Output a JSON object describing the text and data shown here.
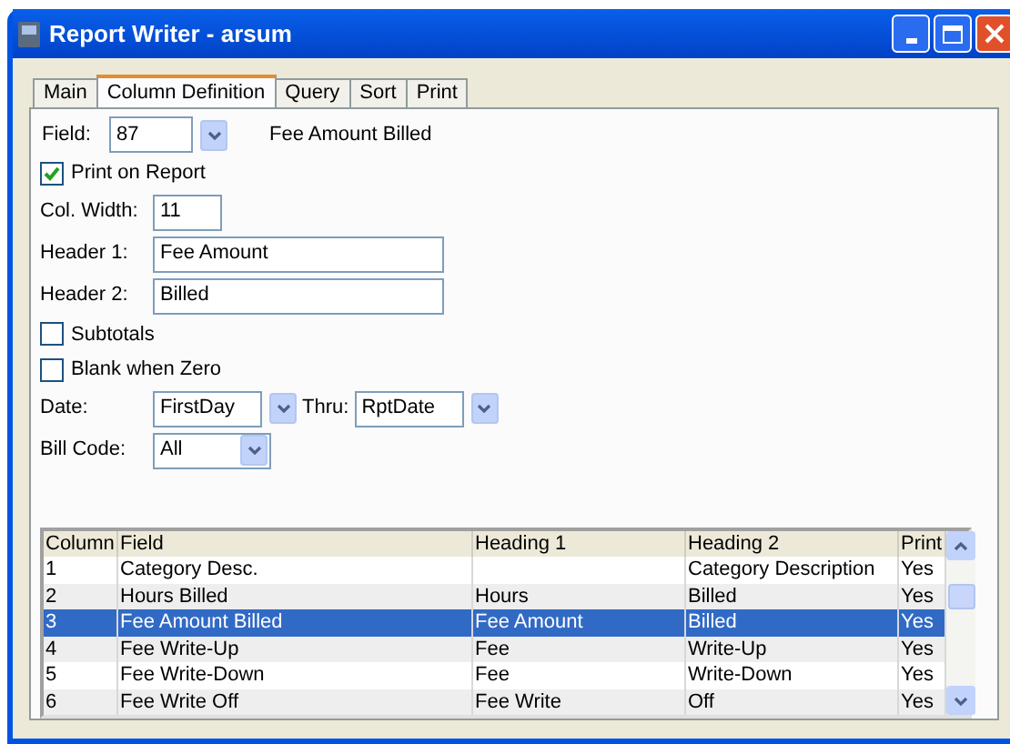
{
  "window": {
    "title": "Report Writer - arsum"
  },
  "tabs": [
    {
      "label": "Main",
      "selected": false
    },
    {
      "label": "Column Definition",
      "selected": true
    },
    {
      "label": "Query",
      "selected": false
    },
    {
      "label": "Sort",
      "selected": false
    },
    {
      "label": "Print",
      "selected": false
    }
  ],
  "field": {
    "label": "Field:",
    "value": "87",
    "description": "Fee Amount Billed"
  },
  "print_on_report": {
    "label": "Print on Report",
    "checked": true
  },
  "col_width": {
    "label": "Col. Width:",
    "value": "11"
  },
  "header_1": {
    "label": "Header 1:",
    "value": "Fee Amount"
  },
  "header_2": {
    "label": "Header 2:",
    "value": "Billed"
  },
  "subtotals": {
    "label": "Subtotals",
    "checked": false
  },
  "blank_when_zero": {
    "label": "Blank when Zero",
    "checked": false
  },
  "date": {
    "label": "Date:",
    "value": "FirstDay",
    "thru_label": "Thru:",
    "thru_value": "RptDate"
  },
  "bill_code": {
    "label": "Bill Code:",
    "value": "All"
  },
  "table": {
    "columns": [
      "Column",
      "Field",
      "Heading 1",
      "Heading 2",
      "Print"
    ],
    "rows": [
      {
        "cells": [
          "1",
          "Category Desc.",
          "",
          "Category Description",
          "Yes"
        ],
        "selected": false
      },
      {
        "cells": [
          "2",
          "Hours Billed",
          "Hours",
          "Billed",
          "Yes"
        ],
        "selected": false
      },
      {
        "cells": [
          "3",
          "Fee Amount Billed",
          "Fee Amount",
          "Billed",
          "Yes"
        ],
        "selected": true
      },
      {
        "cells": [
          "4",
          "Fee Write-Up",
          "Fee",
          "Write-Up",
          "Yes"
        ],
        "selected": false
      },
      {
        "cells": [
          "5",
          "Fee Write-Down",
          "Fee",
          "Write-Down",
          "Yes"
        ],
        "selected": false
      },
      {
        "cells": [
          "6",
          "Fee Write Off",
          "Fee Write",
          "Off",
          "Yes"
        ],
        "selected": false
      }
    ]
  }
}
